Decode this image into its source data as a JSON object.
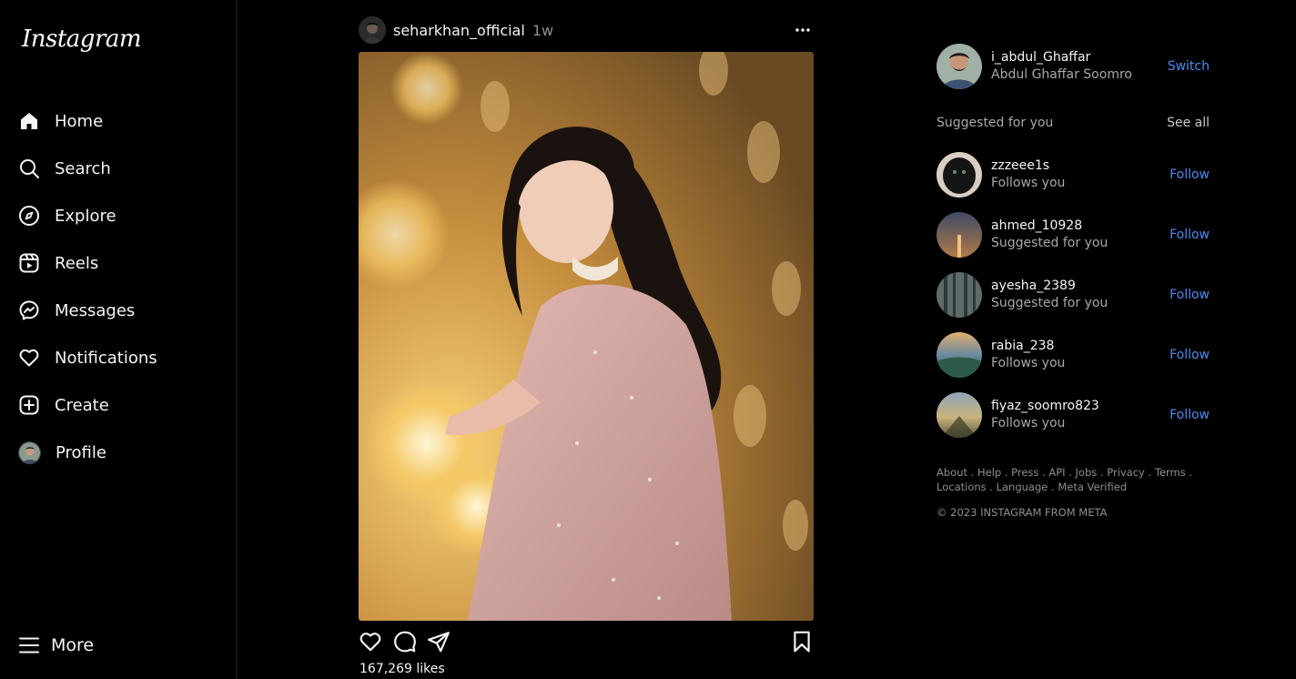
{
  "sidebar": {
    "logo": "Instagram",
    "items": [
      {
        "label": "Home",
        "icon": "home-icon"
      },
      {
        "label": "Search",
        "icon": "search-icon"
      },
      {
        "label": "Explore",
        "icon": "compass-icon"
      },
      {
        "label": "Reels",
        "icon": "reels-icon"
      },
      {
        "label": "Messages",
        "icon": "messenger-icon"
      },
      {
        "label": "Notifications",
        "icon": "heart-icon"
      },
      {
        "label": "Create",
        "icon": "plus-square-icon"
      },
      {
        "label": "Profile",
        "icon": "avatar"
      }
    ],
    "more_label": "More"
  },
  "post": {
    "username": "seharkhan_official",
    "time": "1w",
    "likes": "167,269 likes"
  },
  "current_user": {
    "username": "i_abdul_Ghaffar",
    "full_name": "Abdul Ghaffar Soomro",
    "action": "Switch"
  },
  "suggestions": {
    "title": "Suggested for you",
    "see_all": "See all",
    "items": [
      {
        "username": "zzzeee1s",
        "subtitle": "Follows you",
        "action": "Follow"
      },
      {
        "username": "ahmed_10928",
        "subtitle": "Suggested for you",
        "action": "Follow"
      },
      {
        "username": "ayesha_2389",
        "subtitle": "Suggested for you",
        "action": "Follow"
      },
      {
        "username": "rabia_238",
        "subtitle": "Follows you",
        "action": "Follow"
      },
      {
        "username": "fiyaz_soomro823",
        "subtitle": "Follows you",
        "action": "Follow"
      }
    ]
  },
  "footer": {
    "links_line1": "About . Help . Press . API . Jobs . Privacy . Terms .",
    "links_line2": "Locations . Language . Meta Verified",
    "copyright": "© 2023 INSTAGRAM FROM META"
  },
  "colors": {
    "background": "#000000",
    "link_blue": "#4a8cf0",
    "muted": "#a8a8a8"
  }
}
